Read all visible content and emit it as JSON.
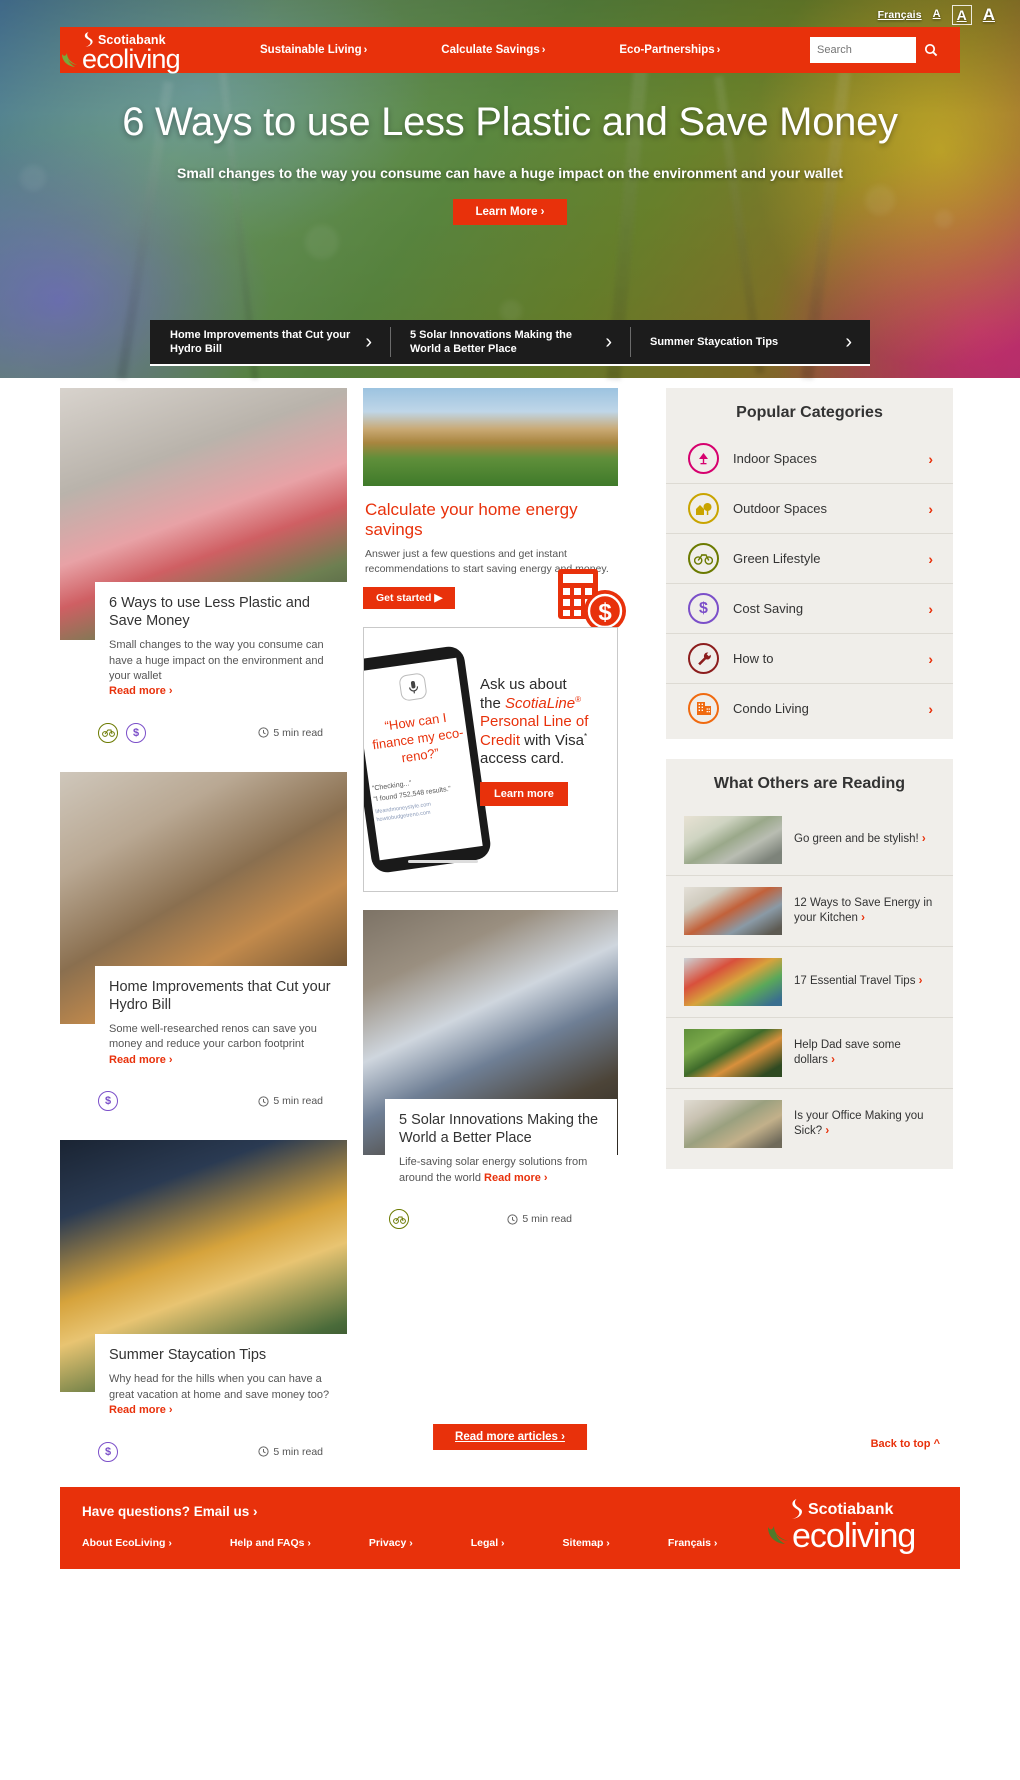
{
  "utility": {
    "language": "Français",
    "font_sizes": [
      "A",
      "A",
      "A"
    ],
    "selected_font_size_index": 1
  },
  "header": {
    "brand_top": "Scotiabank",
    "brand_main": "ecoliving",
    "nav": [
      {
        "label": "Sustainable Living",
        "chevron": "›"
      },
      {
        "label": "Calculate Savings",
        "chevron": "›"
      },
      {
        "label": "Eco-Partnerships",
        "chevron": "›"
      }
    ],
    "search_placeholder": "Search",
    "search_value": "",
    "search_icon": "search-icon"
  },
  "hero": {
    "title": "6 Ways to use Less Plastic and Save Money",
    "subtitle": "Small changes to the way you consume can have a huge impact on the environment and your wallet",
    "cta": "Learn More ›"
  },
  "carousel": [
    {
      "title": "Home Improvements that Cut your Hydro Bill",
      "arrow": "›"
    },
    {
      "title": "5 Solar Innovations Making the World a Better Place",
      "arrow": "›"
    },
    {
      "title": "Summer Staycation Tips",
      "arrow": "›"
    }
  ],
  "articles": [
    {
      "title": "6 Ways to use Less Plastic and Save Money",
      "desc": "Small changes to the way you consume can have a huge impact on the environment and your wallet",
      "read_more": "Read more ›",
      "tags": [
        "bicycle-icon",
        "dollar-icon"
      ],
      "read_time": "5 min read",
      "image": "woman-with-groceries"
    },
    {
      "title": "Home Improvements that Cut your Hydro Bill",
      "desc": "Some well-researched renos can save you money and reduce your carbon footprint",
      "read_more": "Read more ›",
      "tags": [
        "dollar-icon"
      ],
      "read_time": "5 min read",
      "image": "man-with-dog-renovating"
    },
    {
      "title": "Summer Staycation Tips",
      "desc": "Why head for the hills when you can have a great vacation at home and save money too?",
      "read_more": "Read more ›",
      "tags": [
        "dollar-icon"
      ],
      "read_time": "5 min read",
      "image": "child-reading-in-tent"
    },
    {
      "title": "5 Solar Innovations Making the World a Better Place",
      "desc": "Life-saving solar energy solutions from around the world",
      "read_more": "Read more ›",
      "tags": [
        "bicycle-icon"
      ],
      "read_time": "5 min read",
      "image": "solar-panel"
    }
  ],
  "calc_promo": {
    "title": "Calculate your home energy savings",
    "desc": "Answer just a few questions and get instant recommendations to start saving energy and money.",
    "cta": "Get started",
    "cta_icon": "play-triangle-icon",
    "image": "suburban-house"
  },
  "credit_ad": {
    "phone_quote": "“How can I finance my eco-reno?”",
    "phone_result_1": "“Checking...”",
    "phone_result_2": "“I found 752,548 results.”",
    "phone_result_3": "lifeandmoneystyle.com  howtobudgetreno.com",
    "line1": "Ask us about",
    "line2_pre": "the ",
    "line2_brand": "ScotiaLine",
    "line2_sup": "®",
    "line3": "Personal Line of",
    "line4_pre": "Credit",
    "line4_post": " with Visa",
    "line4_sup": "*",
    "line5": "access card.",
    "cta": "Learn more",
    "mic_icon": "microphone-icon"
  },
  "popular_categories": {
    "heading": "Popular Categories",
    "items": [
      {
        "label": "Indoor Spaces",
        "icon": "lamp-icon",
        "color": "#d6006e",
        "chevron": "›"
      },
      {
        "label": "Outdoor Spaces",
        "icon": "house-tree-icon",
        "color": "#c9a400",
        "chevron": "›"
      },
      {
        "label": "Green Lifestyle",
        "icon": "bicycle-icon",
        "color": "#6b7a00",
        "chevron": "›"
      },
      {
        "label": "Cost Saving",
        "icon": "dollar-icon",
        "color": "#7b4fc9",
        "chevron": "›"
      },
      {
        "label": "How to",
        "icon": "wrench-icon",
        "color": "#8c1d1d",
        "chevron": "›"
      },
      {
        "label": "Condo Living",
        "icon": "building-icon",
        "color": "#f06a10",
        "chevron": "›"
      }
    ]
  },
  "what_others_reading": {
    "heading": "What Others are Reading",
    "items": [
      {
        "title": "Go green and be stylish!",
        "chevron": "›",
        "image": "kitchen-faucet"
      },
      {
        "title": "12 Ways to Save Energy in your Kitchen",
        "chevron": "›",
        "image": "people-cooking"
      },
      {
        "title": "17 Essential Travel Tips",
        "chevron": "›",
        "image": "packed-luggage"
      },
      {
        "title": "Help Dad save some dollars",
        "chevron": "›",
        "image": "lawn-mower"
      },
      {
        "title": "Is your Office Making you Sick?",
        "chevron": "›",
        "image": "office-worker"
      }
    ]
  },
  "bottom": {
    "read_more_articles": "Read more articles ›",
    "back_to_top": "Back to top",
    "back_to_top_icon": "chevron-up-icon"
  },
  "footer": {
    "question": "Have questions? Email us ›",
    "links": [
      {
        "label": "About EcoLiving ›"
      },
      {
        "label": "Help and FAQs ›"
      },
      {
        "label": "Privacy ›"
      },
      {
        "label": "Legal ›"
      },
      {
        "label": "Sitemap ›"
      },
      {
        "label": "Français ›"
      }
    ],
    "brand_top": "Scotiabank",
    "brand_main": "ecoliving"
  },
  "colors": {
    "brand_red": "#e8310b",
    "panel_bg": "#f0eeea",
    "strip_bg": "#1c1c1c"
  }
}
